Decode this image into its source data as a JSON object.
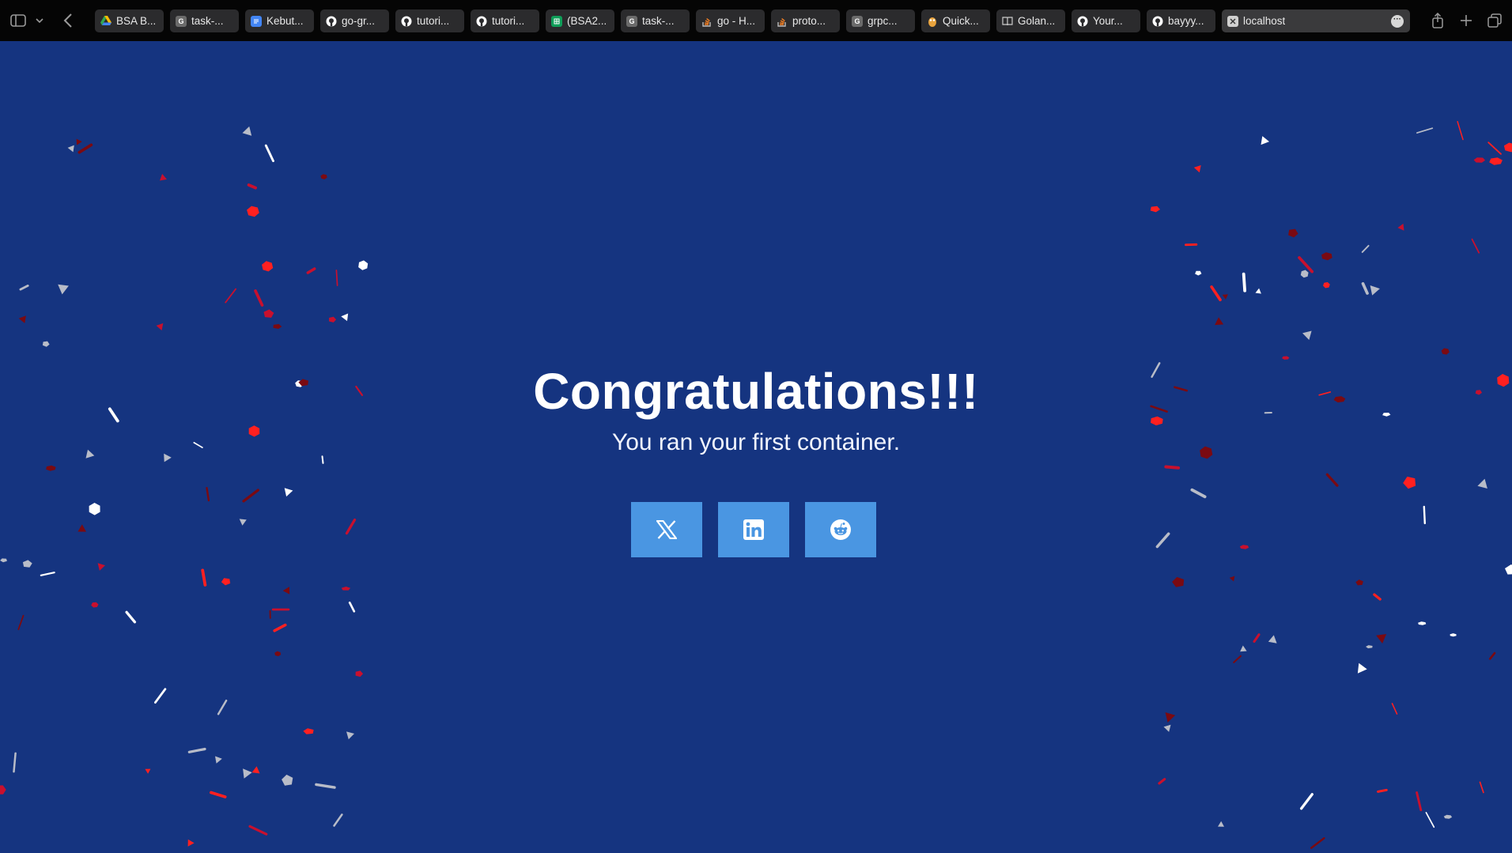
{
  "browser": {
    "tabs": [
      {
        "label": "BSA B...",
        "icon": "google-drive-icon",
        "color": "#34a853"
      },
      {
        "label": "task-...",
        "icon": "g-icon",
        "color": "#6b6b6b"
      },
      {
        "label": "Kebut...",
        "icon": "docs-icon",
        "color": "#4285f4"
      },
      {
        "label": "go-gr...",
        "icon": "github-icon",
        "color": "#ffffff"
      },
      {
        "label": "tutori...",
        "icon": "github-icon",
        "color": "#ffffff"
      },
      {
        "label": "tutori...",
        "icon": "github-icon",
        "color": "#ffffff"
      },
      {
        "label": "(BSA2...",
        "icon": "sheets-icon",
        "color": "#0f9d58"
      },
      {
        "label": "task-...",
        "icon": "g-icon",
        "color": "#6b6b6b"
      },
      {
        "label": "go - H...",
        "icon": "stackoverflow-icon",
        "color": "#f48024"
      },
      {
        "label": "proto...",
        "icon": "stackoverflow-icon",
        "color": "#f48024"
      },
      {
        "label": "grpc...",
        "icon": "g-icon",
        "color": "#6b6b6b"
      },
      {
        "label": "Quick...",
        "icon": "gopher-icon",
        "color": "#e8a33d"
      },
      {
        "label": "Golan...",
        "icon": "book-icon",
        "color": "#cccccc"
      },
      {
        "label": "Your...",
        "icon": "github-icon",
        "color": "#ffffff"
      },
      {
        "label": "bayyy...",
        "icon": "github-icon",
        "color": "#ffffff"
      }
    ],
    "active_tab": {
      "label": "localhost",
      "icon": "site-icon"
    }
  },
  "page": {
    "title": "Congratulations!!!",
    "subtitle": "You ran your first container.",
    "share": [
      {
        "name": "x",
        "icon": "x-icon"
      },
      {
        "name": "linkedin",
        "icon": "linkedin-icon"
      },
      {
        "name": "reddit",
        "icon": "reddit-icon"
      }
    ]
  },
  "colors": {
    "background": "#153480",
    "share_button": "#4a96e2",
    "confetti": [
      "#ff2020",
      "#c8102e",
      "#7a0a12",
      "#ffffff",
      "#b8bcc8"
    ]
  }
}
